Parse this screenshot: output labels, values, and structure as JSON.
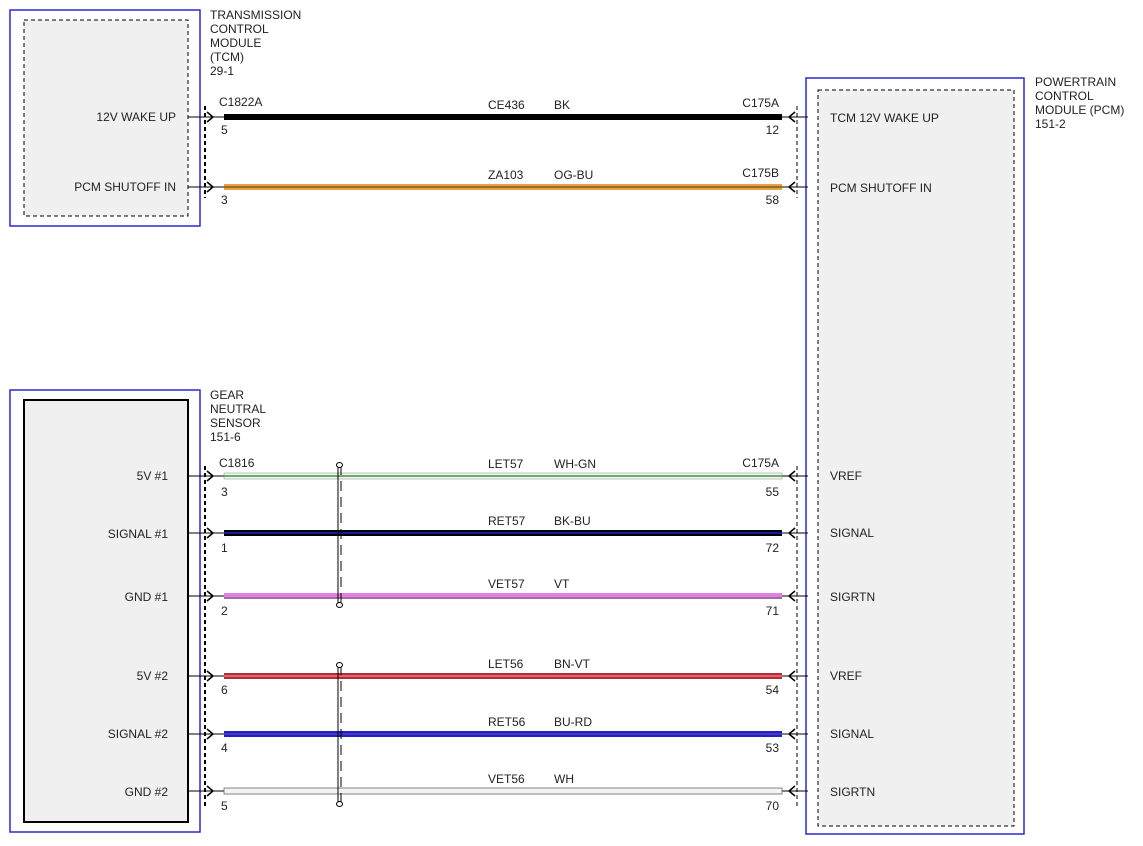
{
  "tcm": {
    "title_lines": [
      "TRANSMISSION",
      "CONTROL",
      "MODULE",
      "(TCM)",
      "29-1"
    ],
    "pins": [
      "12V WAKE UP",
      "PCM SHUTOFF IN"
    ],
    "connector": "C1822A"
  },
  "pcm": {
    "title_lines": [
      "POWERTRAIN",
      "CONTROL",
      "MODULE (PCM)",
      "151-2"
    ],
    "pins": [
      "TCM 12V WAKE UP",
      "PCM SHUTOFF IN",
      "VREF",
      "SIGNAL",
      "SIGRTN",
      "VREF",
      "SIGNAL",
      "SIGRTN"
    ]
  },
  "gns": {
    "title_lines": [
      "GEAR",
      "NEUTRAL",
      "SENSOR",
      "151-6"
    ],
    "pins": [
      "5V #1",
      "SIGNAL #1",
      "GND #1",
      "5V #2",
      "SIGNAL #2",
      "GND #2"
    ],
    "connector": "C1816"
  },
  "wires": [
    {
      "circuit": "CE436",
      "color_code": "BK",
      "left_pin": "5",
      "right_conn": "C175A",
      "right_pin": "12",
      "primary": "#000000",
      "stripe": "#000000"
    },
    {
      "circuit": "ZA103",
      "color_code": "OG-BU",
      "left_pin": "3",
      "right_conn": "C175B",
      "right_pin": "58",
      "primary": "#e8a040",
      "stripe": "#6a4a20"
    },
    {
      "circuit": "LET57",
      "color_code": "WH-GN",
      "left_pin": "3",
      "right_conn": "C175A",
      "right_pin": "55",
      "primary": "#f4f4f4",
      "stripe": "#3a9a3a"
    },
    {
      "circuit": "RET57",
      "color_code": "BK-BU",
      "left_pin": "1",
      "right_conn": "",
      "right_pin": "72",
      "primary": "#000000",
      "stripe": "#1a1aa0"
    },
    {
      "circuit": "VET57",
      "color_code": "VT",
      "left_pin": "2",
      "right_conn": "",
      "right_pin": "71",
      "primary": "#e080e0",
      "stripe": "#e080e0"
    },
    {
      "circuit": "LET56",
      "color_code": "BN-VT",
      "left_pin": "6",
      "right_conn": "",
      "right_pin": "54",
      "primary": "#b03030",
      "stripe": "#e06080"
    },
    {
      "circuit": "RET56",
      "color_code": "BU-RD",
      "left_pin": "4",
      "right_conn": "",
      "right_pin": "53",
      "primary": "#2020d0",
      "stripe": "#6040a0"
    },
    {
      "circuit": "VET56",
      "color_code": "WH",
      "left_pin": "5",
      "right_conn": "",
      "right_pin": "70",
      "primary": "#f4f4f4",
      "stripe": "#f4f4f4"
    }
  ],
  "colors": {
    "module_border": "#2a2ad0",
    "module_fill": "#f0f0f0"
  }
}
